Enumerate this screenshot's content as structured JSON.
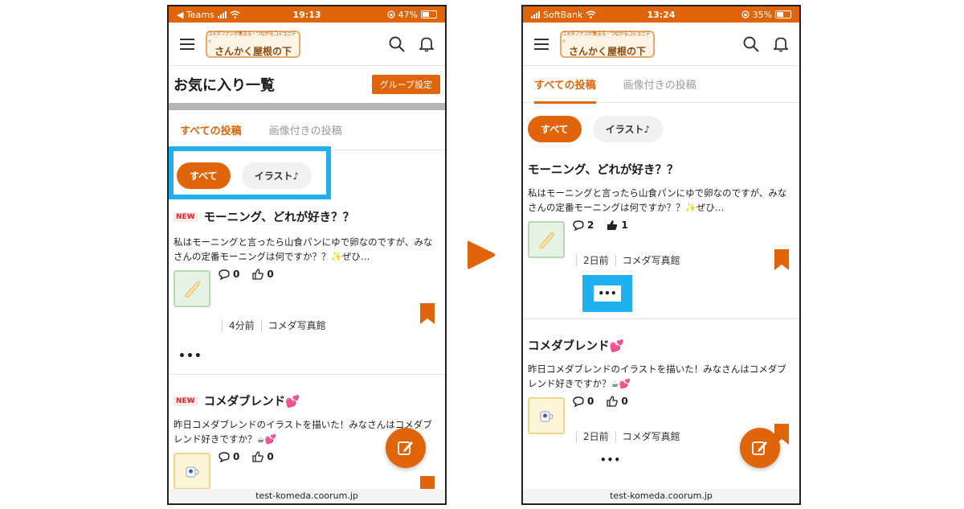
{
  "left_phone": {
    "status": {
      "carrier": "◀ Teams",
      "time": "19:13",
      "battery": "47%"
    },
    "logo": {
      "tagline": "コメダファンが集まる・つながるコミュニティ",
      "name": "さんかく屋根の下"
    },
    "page_title": "お気に入り一覧",
    "group_button": "グループ設定",
    "tabs": [
      "すべての投稿",
      "画像付きの投稿"
    ],
    "chips": [
      "すべて",
      "イラスト♪"
    ],
    "posts": [
      {
        "badge": "NEW",
        "title": "モーニング、どれが好き？？",
        "body": "私はモーニングと言ったら山食パンにゆで卵なのですが、みなさんの定番モーニングは何ですか？？✨ぜひ…",
        "comments": "0",
        "likes": "0",
        "time": "4分前",
        "author": "コメダ写真館",
        "more": "•••"
      },
      {
        "badge": "NEW",
        "title": "コメダブレンド💕",
        "body": "昨日コメダブレンドのイラストを描いた！みなさんはコメダブレンド好きですか？☕💕",
        "comments": "0",
        "likes": "0"
      }
    ],
    "url": "test-komeda.coorum.jp"
  },
  "right_phone": {
    "status": {
      "carrier": "SoftBank",
      "time": "13:24",
      "battery": "35%"
    },
    "logo": {
      "tagline": "コメダファンが集まる・つながるコミュニティ",
      "name": "さんかく屋根の下"
    },
    "tabs": [
      "すべての投稿",
      "画像付きの投稿"
    ],
    "chips": [
      "すべて",
      "イラスト♪"
    ],
    "posts": [
      {
        "title": "モーニング、どれが好き？？",
        "body": "私はモーニングと言ったら山食パンにゆで卵なのですが、みなさんの定番モーニングは何ですか？？✨ぜひ…",
        "comments": "2",
        "likes": "1",
        "time": "2日前",
        "author": "コメダ写真館",
        "more": "•••"
      },
      {
        "title": "コメダブレンド💕",
        "body": "昨日コメダブレンドのイラストを描いた！みなさんはコメダブレンド好きですか？☕💕",
        "comments": "0",
        "likes": "0",
        "time": "2日前",
        "author": "コメダ写真館",
        "more": "•••"
      }
    ],
    "url": "test-komeda.coorum.jp"
  },
  "colors": {
    "brand": "#e0650a",
    "highlight": "#1fb0f0",
    "arrow": "#e0650a"
  }
}
